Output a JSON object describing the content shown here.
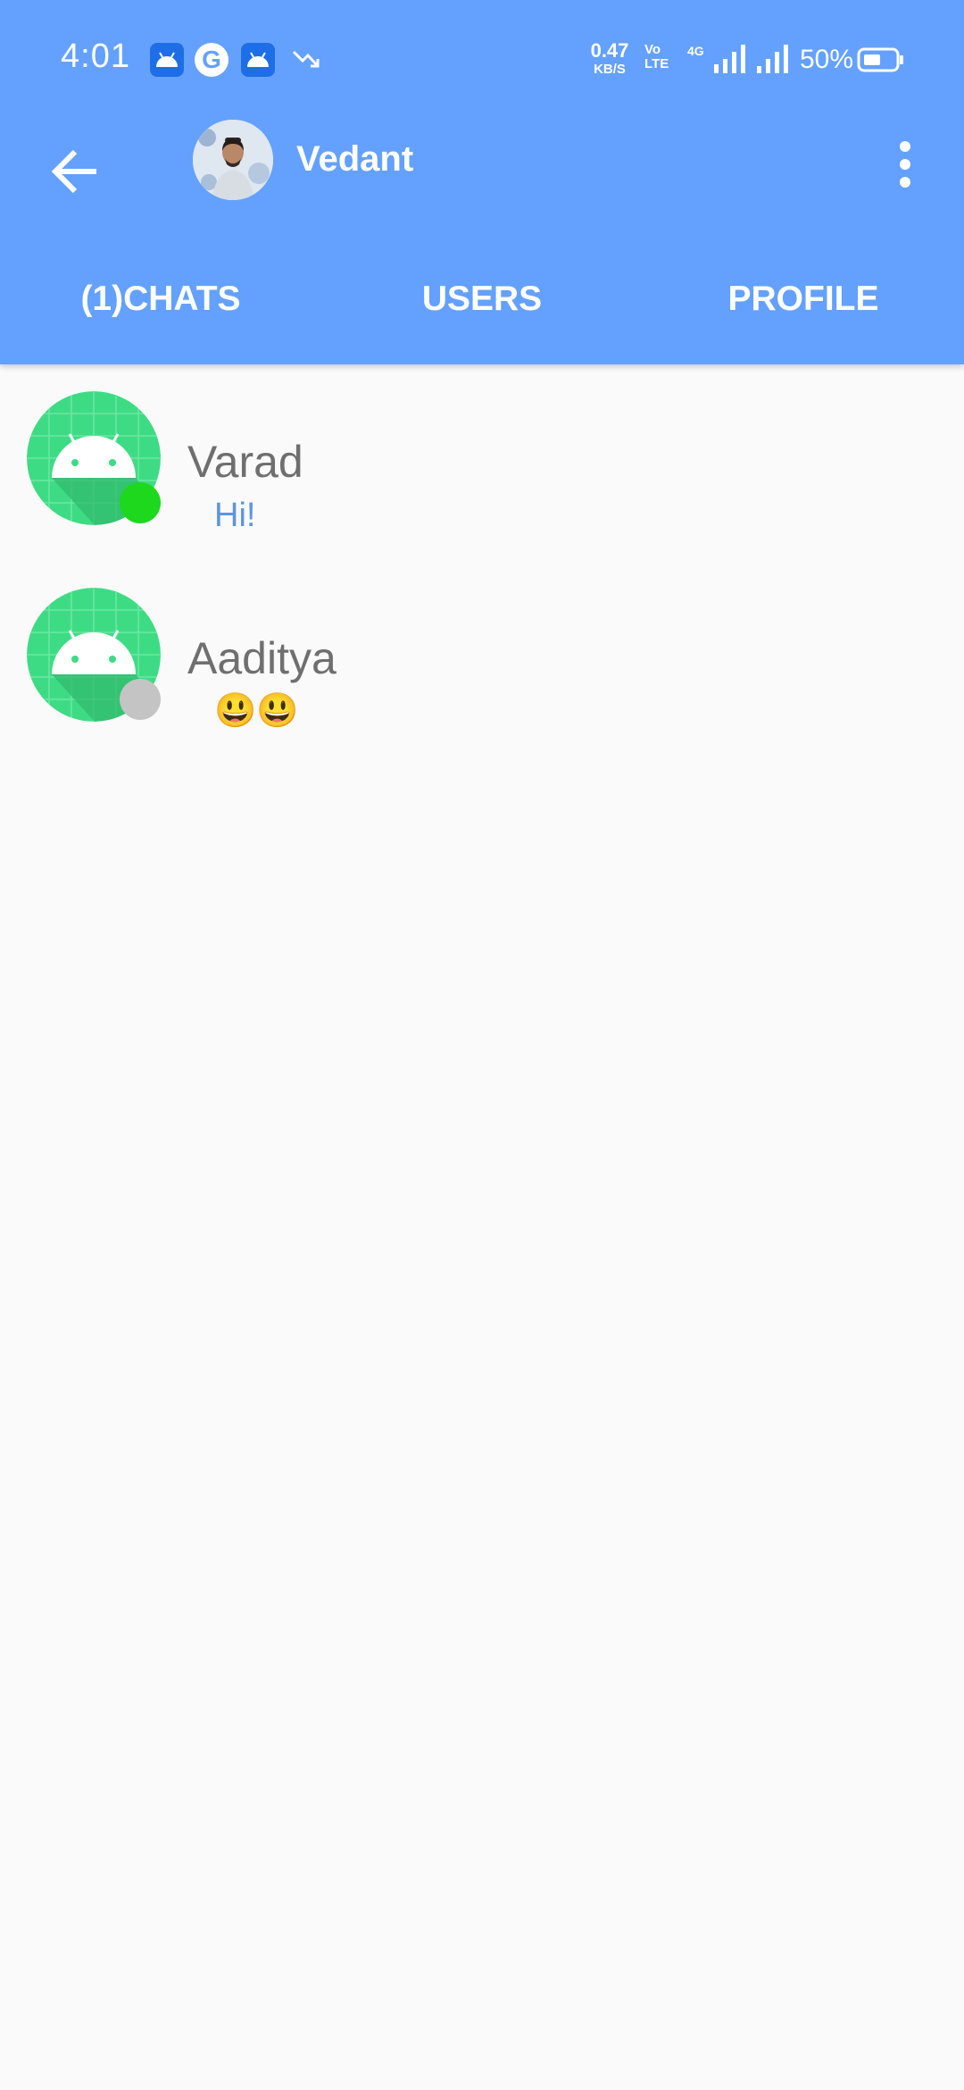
{
  "status_bar": {
    "time": "4:01",
    "net_speed_value": "0.47",
    "net_speed_unit": "KB/S",
    "volte_line1": "Vo",
    "volte_line2": "LTE",
    "network_type": "4G",
    "battery_percent": "50%",
    "icons": [
      "android-notification-icon",
      "google-icon",
      "android-notification-icon",
      "trending-down-icon",
      "signal-icon",
      "battery-icon"
    ]
  },
  "toolbar": {
    "title": "Vedant",
    "icons": [
      "arrow-back-icon",
      "more-vert-icon"
    ]
  },
  "tabs": [
    {
      "label": "(1)CHATS"
    },
    {
      "label": "USERS"
    },
    {
      "label": "PROFILE"
    }
  ],
  "chats": [
    {
      "name": "Varad",
      "last_message": "Hi!",
      "online": true,
      "message_color": "#5f95e0"
    },
    {
      "name": "Aaditya",
      "last_message": "😃😃",
      "online": false,
      "message_color": "#6f6f6f"
    }
  ],
  "colors": {
    "app_bar": "#64a1ff",
    "online_dot": "#1ed81e",
    "offline_dot": "#c4c4c4",
    "background": "#fafafa"
  }
}
